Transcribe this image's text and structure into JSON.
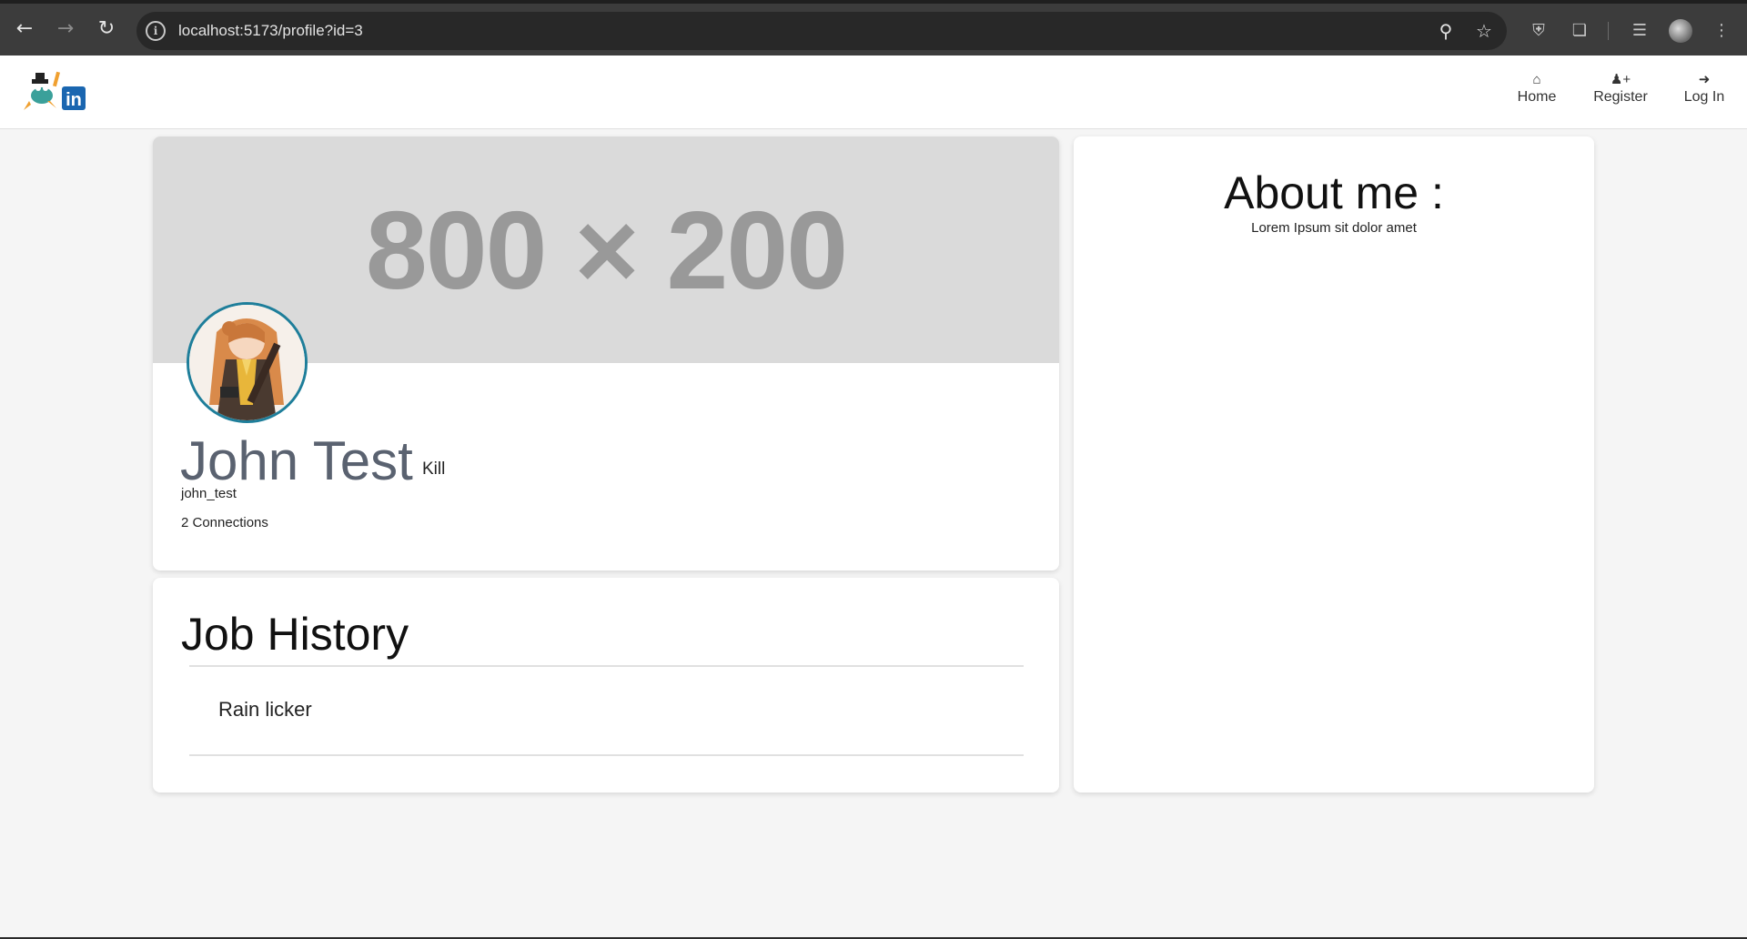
{
  "browser": {
    "url": "localhost:5173/profile?id=3",
    "icons": {
      "back": "arrow-left-icon",
      "forward": "arrow-right-icon",
      "reload": "reload-icon",
      "zoom": "zoom-icon",
      "bookmark": "star-icon",
      "extensions": "puzzle-icon",
      "menu": "more-vert-icon"
    }
  },
  "navbar": {
    "items": [
      {
        "label": "Home",
        "icon": "home-icon"
      },
      {
        "label": "Register",
        "icon": "user-plus-icon"
      },
      {
        "label": "Log In",
        "icon": "sign-in-icon"
      }
    ]
  },
  "profile": {
    "banner_text": "800 × 200",
    "name": "John Test",
    "headline": "Kill",
    "username": "john_test",
    "connections": "2 Connections"
  },
  "job_history": {
    "title": "Job History",
    "items": [
      "Rain licker"
    ]
  },
  "about": {
    "title": "About me :",
    "text": "Lorem Ipsum sit dolor amet"
  },
  "colors": {
    "avatar_border": "#1e7e9a",
    "name": "#5a6270",
    "banner_bg": "#dadada",
    "page_bg": "#f5f5f5"
  }
}
